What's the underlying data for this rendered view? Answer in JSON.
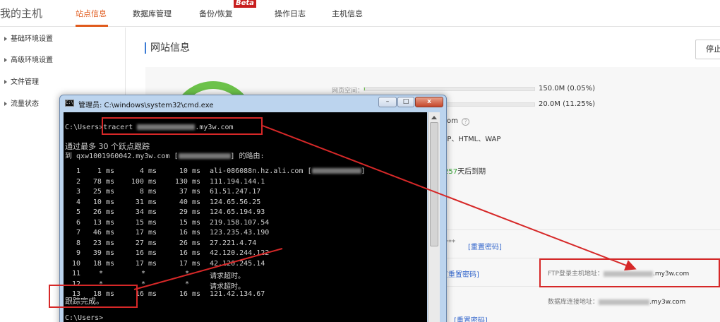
{
  "nav": {
    "brand": "我的主机",
    "tabs": [
      {
        "label": "站点信息",
        "active": true
      },
      {
        "label": "数据库管理",
        "active": false
      },
      {
        "label": "备份/恢复",
        "active": false
      },
      {
        "label": "操作日志",
        "active": false
      },
      {
        "label": "主机信息",
        "active": false
      }
    ],
    "beta_badge": "Beta"
  },
  "sidebar": {
    "items": [
      {
        "label": "基础环境设置"
      },
      {
        "label": "高级环境设置"
      },
      {
        "label": "文件管理"
      },
      {
        "label": "流量状态"
      }
    ]
  },
  "main": {
    "title": "网站信息",
    "stop_button": "停止",
    "web_space_label": "网页空间：",
    "web_space_value": "150.0M (0.05%)",
    "web_space_fraction": 0.0005,
    "second_quota_value": "20.0M (11.25%)",
    "second_quota_fraction": 0.1125,
    "domain_suffix": "om",
    "lang_partial": "SP、HTML、WAP",
    "expiry_days": "257",
    "expiry_suffix": "天后到期",
    "password_mask": "***",
    "reset_password": "[重置密码]",
    "ftp_label": "FTP登录主机地址：",
    "ftp_host": ".my3w.com",
    "db_label": "数据库连接地址：",
    "db_host": ".my3w.com"
  },
  "cmd": {
    "title": "管理员: C:\\windows\\system32\\cmd.exe",
    "prompt": "C:\\Users>",
    "command": "tracert ",
    "command_host_suffix": ".my3w.com",
    "header1": "通过最多 30 个跃点跟踪",
    "header2_prefix": "到 qxw1001960042.my3w.com [",
    "header2_suffix": "] 的路由:",
    "hops": [
      {
        "n": "1",
        "t1": "1 ms",
        "t2": "4 ms",
        "t3": "10 ms",
        "host": "ali-086088n.hz.ali.com ["
      },
      {
        "n": "2",
        "t1": "78 ms",
        "t2": "100 ms",
        "t3": "130 ms",
        "host": "111.194.144.1"
      },
      {
        "n": "3",
        "t1": "25 ms",
        "t2": "8 ms",
        "t3": "37 ms",
        "host": "61.51.247.17"
      },
      {
        "n": "4",
        "t1": "10 ms",
        "t2": "31 ms",
        "t3": "40 ms",
        "host": "124.65.56.25"
      },
      {
        "n": "5",
        "t1": "26 ms",
        "t2": "34 ms",
        "t3": "29 ms",
        "host": "124.65.194.93"
      },
      {
        "n": "6",
        "t1": "13 ms",
        "t2": "15 ms",
        "t3": "15 ms",
        "host": "219.158.107.54"
      },
      {
        "n": "7",
        "t1": "46 ms",
        "t2": "17 ms",
        "t3": "16 ms",
        "host": "123.235.43.190"
      },
      {
        "n": "8",
        "t1": "23 ms",
        "t2": "27 ms",
        "t3": "26 ms",
        "host": "27.221.4.74"
      },
      {
        "n": "9",
        "t1": "39 ms",
        "t2": "16 ms",
        "t3": "16 ms",
        "host": "42.120.244.122"
      },
      {
        "n": "10",
        "t1": "18 ms",
        "t2": "17 ms",
        "t3": "17 ms",
        "host": "42.120.245.14"
      },
      {
        "n": "11",
        "t1": "*",
        "t2": "*",
        "t3": "*",
        "host": "请求超时。"
      },
      {
        "n": "12",
        "t1": "*",
        "t2": "*",
        "t3": "*",
        "host": "请求超时。"
      },
      {
        "n": "13",
        "t1": "18 ms",
        "t2": "16 ms",
        "t3": "16 ms",
        "host": "121.42.134.67"
      }
    ],
    "done": "跟踪完成。",
    "final_prompt": "C:\\Users>",
    "win_buttons": {
      "minimize": "–",
      "maximize": "□",
      "close": "x"
    }
  },
  "colors": {
    "accent": "#e05a1c",
    "annotation_red": "#d62828",
    "progress_green": "#6cc24a",
    "link_blue": "#3366cc"
  }
}
